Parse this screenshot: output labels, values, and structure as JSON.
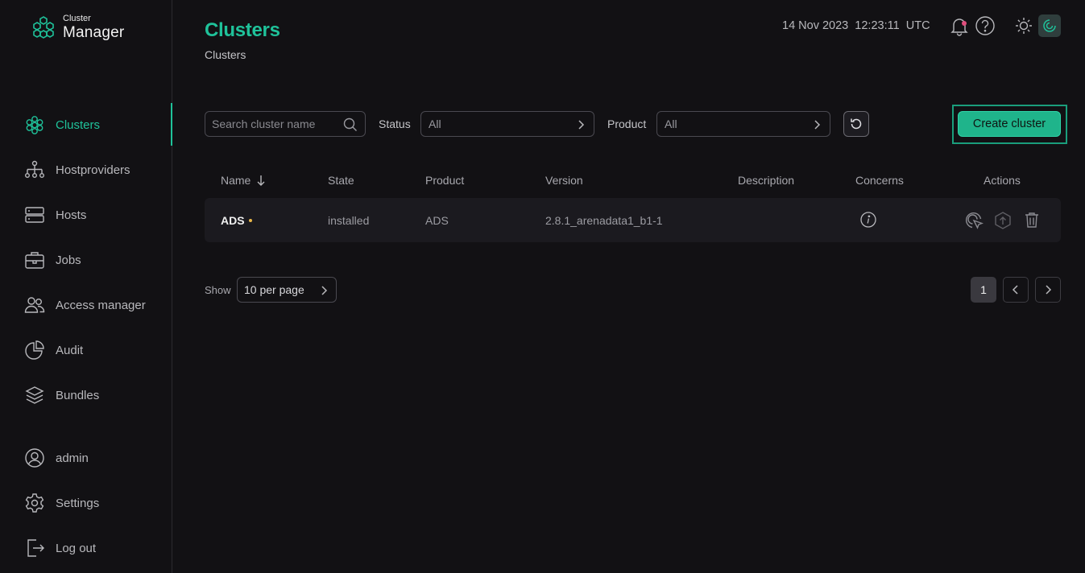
{
  "app": {
    "logo_small": "Cluster",
    "logo_big": "Manager"
  },
  "sidebar": {
    "items": [
      {
        "label": "Clusters",
        "icon": "clusters-icon",
        "active": true
      },
      {
        "label": "Hostproviders",
        "icon": "hostproviders-icon"
      },
      {
        "label": "Hosts",
        "icon": "hosts-icon"
      },
      {
        "label": "Jobs",
        "icon": "jobs-icon"
      },
      {
        "label": "Access manager",
        "icon": "access-manager-icon"
      },
      {
        "label": "Audit",
        "icon": "audit-icon"
      },
      {
        "label": "Bundles",
        "icon": "bundles-icon"
      }
    ],
    "bottom_items": [
      {
        "label": "admin",
        "icon": "user-icon"
      },
      {
        "label": "Settings",
        "icon": "settings-icon"
      },
      {
        "label": "Log out",
        "icon": "logout-icon"
      }
    ]
  },
  "header": {
    "title": "Clusters",
    "breadcrumb": "Clusters",
    "date": "14 Nov 2023",
    "time": "12:23:11",
    "timezone": "UTC"
  },
  "toolbar": {
    "search_placeholder": "Search cluster name",
    "status_label": "Status",
    "status_value": "All",
    "product_label": "Product",
    "product_value": "All",
    "create_label": "Create cluster"
  },
  "table": {
    "columns": [
      "Name",
      "State",
      "Product",
      "Version",
      "Description",
      "Concerns",
      "Actions"
    ],
    "rows": [
      {
        "name": "ADS",
        "state": "installed",
        "product": "ADS",
        "version": "2.8.1_arenadata1_b1-1",
        "description": ""
      }
    ]
  },
  "pagination": {
    "show_label": "Show",
    "per_page": "10 per page",
    "current_page": "1"
  },
  "colors": {
    "accent": "#1fc29a",
    "background": "#121114",
    "row_background": "#1b1a1f",
    "status_dot": "#e9b84a",
    "notification_dot": "#e04d7c"
  }
}
